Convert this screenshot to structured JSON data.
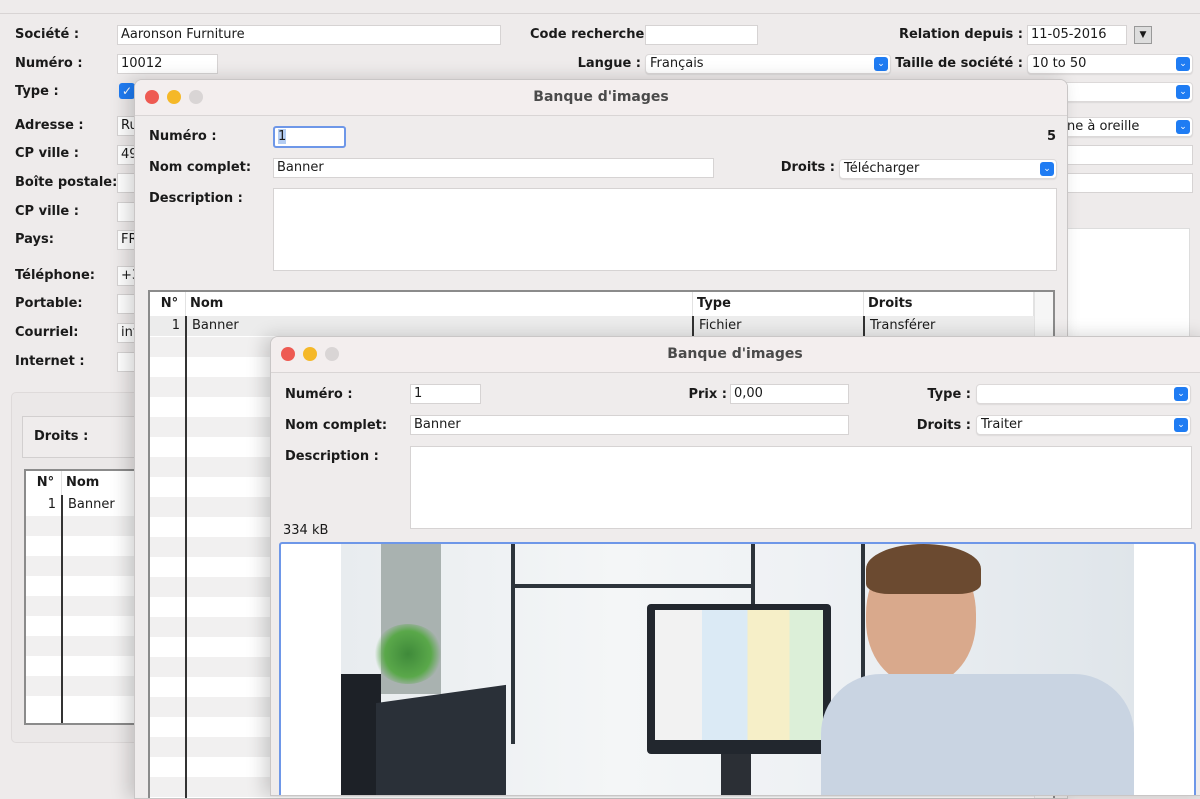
{
  "background_form": {
    "societe": {
      "label": "Société :",
      "value": "Aaronson Furniture"
    },
    "code_recherche": {
      "label": "Code recherche:",
      "value": ""
    },
    "relation_depuis": {
      "label": "Relation depuis :",
      "value": "11-05-2016"
    },
    "numero": {
      "label": "Numéro :",
      "value": "10012"
    },
    "langue": {
      "label": "Langue :",
      "value": "Français"
    },
    "taille": {
      "label": "Taille de société :",
      "value": "10 to 50"
    },
    "type": {
      "label": "Type :",
      "checked": true
    },
    "source_partial": "ne à oreille",
    "adresse": {
      "label": "Adresse :",
      "value": "Ru"
    },
    "cp_ville": {
      "label": "CP ville :",
      "value": "49"
    },
    "boite_postale": {
      "label": "Boîte postale:",
      "value": ""
    },
    "cp_ville2": {
      "label": "CP ville :",
      "value": ""
    },
    "pays": {
      "label": "Pays:",
      "value": "FR"
    },
    "telephone": {
      "label": "Téléphone:",
      "value": "+3"
    },
    "portable": {
      "label": "Portable:",
      "value": ""
    },
    "courriel": {
      "label": "Courriel:",
      "value": "inf"
    },
    "internet": {
      "label": "Internet :",
      "value": ""
    },
    "droits_label": "Droits :",
    "table": {
      "headers": [
        "N°",
        "Nom"
      ],
      "rows": [
        [
          "1",
          "Banner"
        ]
      ]
    }
  },
  "dialog1": {
    "title": "Banque d'images",
    "numero": {
      "label": "Numéro :",
      "value": "1"
    },
    "count": "5",
    "nom_complet": {
      "label": "Nom complet:",
      "value": "Banner"
    },
    "droits": {
      "label": "Droits :",
      "value": "Télécharger"
    },
    "description": {
      "label": "Description :",
      "value": ""
    },
    "table": {
      "headers": [
        "N°",
        "Nom",
        "Type",
        "Droits"
      ],
      "rows": [
        [
          "1",
          "Banner",
          "Fichier",
          "Transférer"
        ]
      ]
    }
  },
  "dialog2": {
    "title": "Banque d'images",
    "numero": {
      "label": "Numéro :",
      "value": "1"
    },
    "prix": {
      "label": "Prix :",
      "value": "0,00"
    },
    "type": {
      "label": "Type :",
      "value": ""
    },
    "nom_complet": {
      "label": "Nom complet:",
      "value": "Banner"
    },
    "droits": {
      "label": "Droits :",
      "value": "Traiter"
    },
    "description": {
      "label": "Description :",
      "value": ""
    },
    "file_size": "334 kB"
  },
  "colors": {
    "accent": "#1f7cf3",
    "focus_border": "#6e97e8",
    "close": "#ee5a52",
    "minimize": "#f5b828"
  }
}
